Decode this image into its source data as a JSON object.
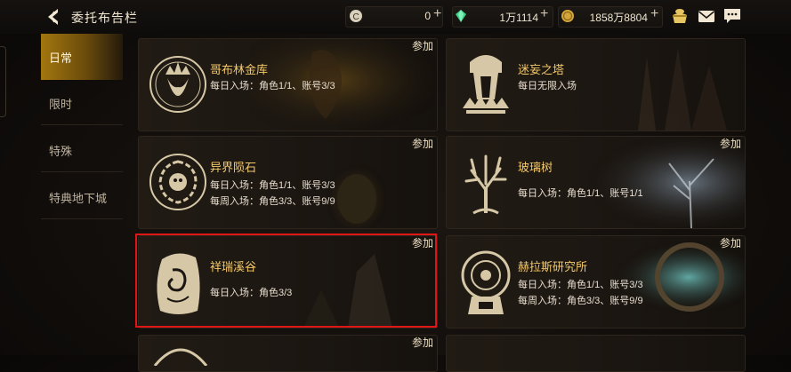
{
  "header": {
    "title": "委托布告栏",
    "coins_value": "0",
    "gems_value": "1万1114",
    "gold_value": "1858万8804"
  },
  "sidebar": {
    "tabs": [
      {
        "label": "日常",
        "active": true
      },
      {
        "label": "限时"
      },
      {
        "label": "特殊"
      },
      {
        "label": "特典地下城"
      }
    ]
  },
  "join_label": "参加",
  "cards": [
    {
      "name": "哥布林金库",
      "lines": [
        "每日入场：角色1/1、账号3/3"
      ],
      "emblem_icon": "crown-icon"
    },
    {
      "name": "迷妄之塔",
      "lines": [
        "每日无限入场"
      ],
      "emblem_icon": "tower-icon"
    },
    {
      "name": "异界陨石",
      "lines": [
        "每日入场：角色1/1、账号3/3",
        "每周入场：角色3/3、账号9/9"
      ],
      "emblem_icon": "meteor-icon"
    },
    {
      "name": "玻璃树",
      "lines": [
        "每日入场：角色1/1、账号1/1"
      ],
      "emblem_icon": "tree-icon"
    },
    {
      "name": "祥瑞溪谷",
      "lines": [
        "每日入场：角色3/3"
      ],
      "emblem_icon": "stone-icon"
    },
    {
      "name": "赫拉斯研究所",
      "lines": [
        "每日入场：角色1/1、账号3/3",
        "每周入场：角色3/3、账号9/9"
      ],
      "emblem_icon": "lab-icon"
    }
  ],
  "colors": {
    "accent_gold": "#f3c86a",
    "highlight_red": "#e01616",
    "tab_active": "#a3760f"
  }
}
